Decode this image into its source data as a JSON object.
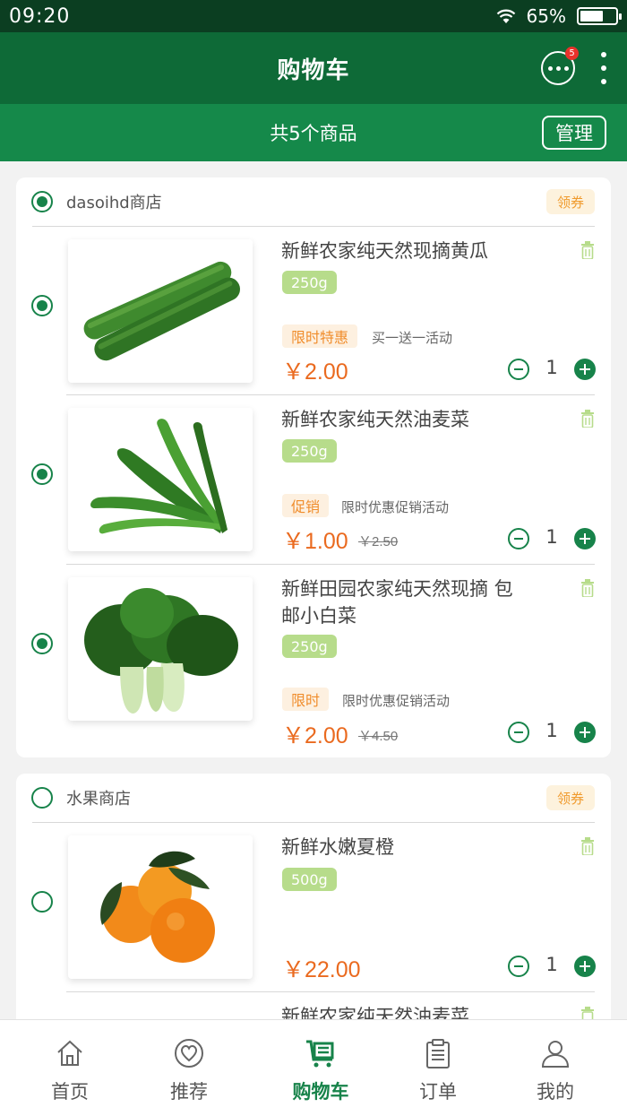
{
  "status_bar": {
    "time": "09:20",
    "battery": "65%",
    "battery_level": 0.65
  },
  "header": {
    "title": "购物车",
    "message_badge": "5"
  },
  "subheader": {
    "count_text": "共5个商品",
    "manage_label": "管理"
  },
  "stores": [
    {
      "name": "dasoihd商店",
      "coupon_label": "领券",
      "checked": true,
      "items": [
        {
          "title": "新鲜农家纯天然现摘黄瓜",
          "spec": "250g",
          "promo_tag": "限时特惠",
          "promo_text": "买一送一活动",
          "price": "￥2.00",
          "old_price": "",
          "qty": "1",
          "image": "cucumber-image",
          "checked": true
        },
        {
          "title": "新鲜农家纯天然油麦菜",
          "spec": "250g",
          "promo_tag": "促销",
          "promo_text": "限时优惠促销活动",
          "price": "￥1.00",
          "old_price": "￥2.50",
          "qty": "1",
          "image": "lettuce-image",
          "checked": true
        },
        {
          "title": "新鲜田园农家纯天然现摘 包邮小白菜",
          "spec": "250g",
          "promo_tag": "限时",
          "promo_text": "限时优惠促销活动",
          "price": "￥2.00",
          "old_price": "￥4.50",
          "qty": "1",
          "image": "bok-choy-image",
          "checked": true
        }
      ]
    },
    {
      "name": "水果商店",
      "coupon_label": "领券",
      "checked": false,
      "items": [
        {
          "title": "新鲜水嫩夏橙",
          "spec": "500g",
          "promo_tag": "",
          "promo_text": "",
          "price": "￥22.00",
          "old_price": "",
          "qty": "1",
          "image": "orange-image",
          "checked": false
        },
        {
          "title": "新鲜农家纯天然油麦菜",
          "spec": "",
          "promo_tag": "",
          "promo_text": "",
          "price": "",
          "old_price": "",
          "qty": "",
          "image": "",
          "checked": false
        }
      ]
    }
  ],
  "bottom_nav": [
    {
      "label": "首页",
      "icon": "home-icon",
      "active": false
    },
    {
      "label": "推荐",
      "icon": "heart-icon",
      "active": false
    },
    {
      "label": "购物车",
      "icon": "cart-icon",
      "active": true
    },
    {
      "label": "订单",
      "icon": "clipboard-icon",
      "active": false
    },
    {
      "label": "我的",
      "icon": "user-icon",
      "active": false
    }
  ],
  "colors": {
    "primary": "#0e6a37",
    "accent": "#15894a",
    "price": "#ea6a1f",
    "spec": "#b7dc8b",
    "coupon": "#f09a2c"
  }
}
